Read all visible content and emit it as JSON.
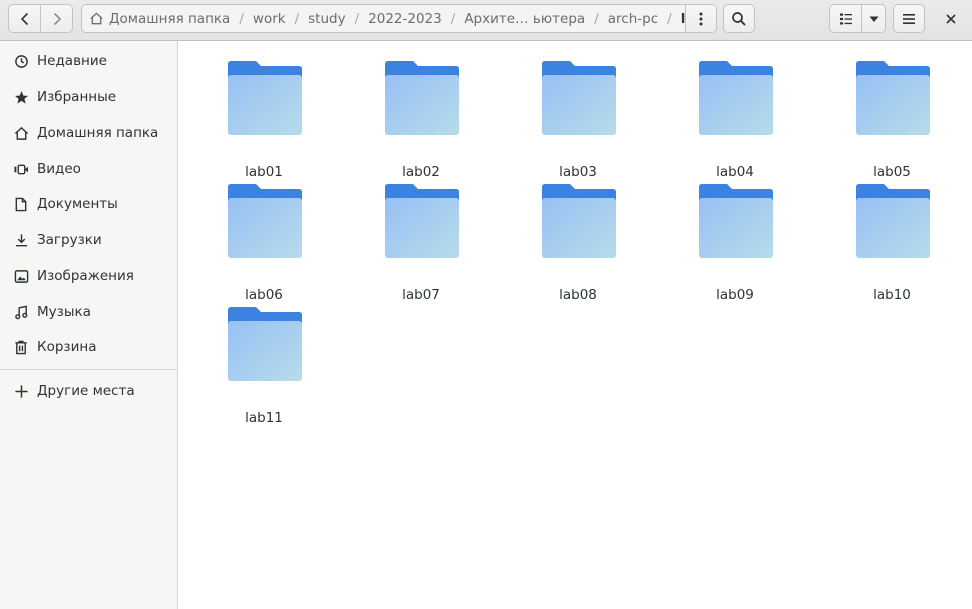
{
  "toolbar": {
    "back_icon": "go-previous-icon",
    "forward_icon": "go-next-icon",
    "search_icon": "search-icon",
    "view_list_icon": "view-list-icon",
    "view_options_icon": "pan-down-icon",
    "menu_icon": "hamburger-menu-icon",
    "close_icon": "close-icon"
  },
  "path": {
    "home": "Домашняя папка",
    "segments": [
      "work",
      "study",
      "2022-2023",
      "Архите… ьютера",
      "arch-pc"
    ],
    "current": "labs"
  },
  "sidebar": {
    "items": [
      {
        "label": "Недавние",
        "icon": "recent-icon"
      },
      {
        "label": "Избранные",
        "icon": "star-icon"
      },
      {
        "label": "Домашняя папка",
        "icon": "home-icon"
      },
      {
        "label": "Видео",
        "icon": "video-icon"
      },
      {
        "label": "Документы",
        "icon": "document-icon"
      },
      {
        "label": "Загрузки",
        "icon": "download-icon"
      },
      {
        "label": "Изображения",
        "icon": "image-icon"
      },
      {
        "label": "Музыка",
        "icon": "music-icon"
      },
      {
        "label": "Корзина",
        "icon": "trash-icon"
      }
    ],
    "other": {
      "label": "Другие места",
      "icon": "plus-icon"
    }
  },
  "folders": [
    "lab01",
    "lab02",
    "lab03",
    "lab04",
    "lab05",
    "lab06",
    "lab07",
    "lab08",
    "lab09",
    "lab10",
    "lab11"
  ],
  "colors": {
    "folder_tab": "#3c82e0",
    "folder_front_top": "#9cc3f3",
    "folder_front_bottom": "#b4dbeb"
  }
}
